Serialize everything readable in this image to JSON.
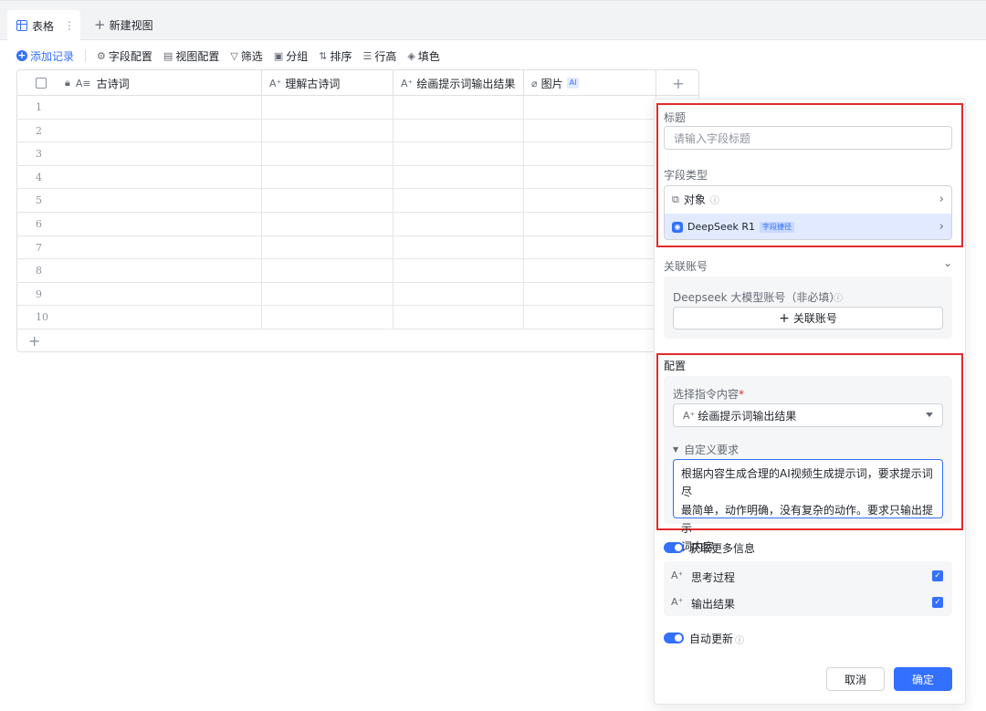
{
  "tabs": {
    "active": "表格",
    "dots": "⋮",
    "new_view": "新建视图"
  },
  "toolbar": {
    "add_record": "添加记录",
    "field_config": "字段配置",
    "view_config": "视图配置",
    "filter": "筛选",
    "group": "分组",
    "sort": "排序",
    "row_height": "行高",
    "fill_color": "填色"
  },
  "table": {
    "columns": [
      "古诗词",
      "理解古诗词",
      "绘画提示词输出结果",
      "图片"
    ],
    "image_badge": "AI",
    "rows": [
      "1",
      "2",
      "3",
      "4",
      "5",
      "6",
      "7",
      "8",
      "9",
      "10"
    ]
  },
  "panel": {
    "title_label": "标题",
    "title_placeholder": "请输入字段标题",
    "field_type_label": "字段类型",
    "type_object": "对象",
    "type_model": "DeepSeek R1",
    "type_model_tag": "字段捷径",
    "linked_account_label": "关联账号",
    "account_hint": "Deepseek 大模型账号（非必填）",
    "link_account_button": "关联账号",
    "config_label": "配置",
    "select_instruction_label": "选择指令内容",
    "required_mark": "*",
    "selected_instruction": "绘画提示词输出结果",
    "custom_requirement_label": "自定义要求",
    "custom_requirement_lines": [
      "根据内容生成合理的AI视频生成提示词，要求提示词尽",
      "最简单，动作明确，没有复杂的动作。要求只输出提示",
      "词内容"
    ],
    "more_info_label": "获取更多信息",
    "thinking_process": "思考过程",
    "output_result": "输出结果",
    "auto_update_label": "自动更新",
    "cancel": "取消",
    "confirm": "确定"
  },
  "colors": {
    "accent": "#3370ff",
    "highlight_border": "#e22b2b"
  },
  "icons": [
    "table-grid-icon",
    "plus-icon",
    "gear-icon",
    "filter-icon",
    "group-icon",
    "sort-icon",
    "row-height-icon",
    "fill-icon",
    "lock-icon",
    "text-field-icon",
    "ai-text-icon",
    "attachment-icon",
    "info-icon",
    "chevron-right-icon",
    "chevron-down-icon",
    "caret-down-icon"
  ]
}
